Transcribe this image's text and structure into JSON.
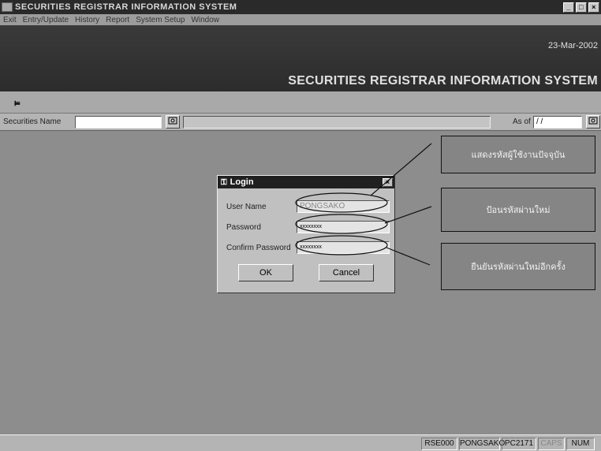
{
  "window": {
    "title": "SECURITIES REGISTRAR INFORMATION SYSTEM",
    "minimize": "_",
    "maximize": "□",
    "close": "×"
  },
  "menu": {
    "items": [
      "Exit",
      "Entry/Update",
      "History",
      "Report",
      "System Setup",
      "Window"
    ]
  },
  "banner": {
    "date": "23-Mar-2002",
    "system_title": "SECURITIES REGISTRAR INFORMATION SYSTEM"
  },
  "filter": {
    "securities_label": "Securities Name",
    "securities_value": "",
    "as_of_label": "As of",
    "as_of_value": "/ /"
  },
  "login": {
    "title": "Login",
    "user_name_label": "User Name",
    "user_name_value": "PONGSAKO",
    "password_label": "Password",
    "password_value": "xxxxxxxx",
    "confirm_label": "Confirm Password",
    "confirm_value": "xxxxxxxx",
    "ok_label": "OK",
    "cancel_label": "Cancel"
  },
  "annotations": {
    "note1": "แสดงรหัสผู้ใช้งานปัจจุบัน",
    "note2": "ป้อนรหัสผ่านใหม่",
    "note3": "ยืนยันรหัสผ่านใหม่อีกครั้ง"
  },
  "status": {
    "code": "RSE000",
    "user": "PONGSAKO",
    "pc": "PC2171",
    "caps": "CAPS",
    "num": "NUM"
  },
  "colors": {
    "titlebar": "#2a2a2a",
    "workspace": "#8d8d8d",
    "dialog": "#c0c0c0"
  }
}
